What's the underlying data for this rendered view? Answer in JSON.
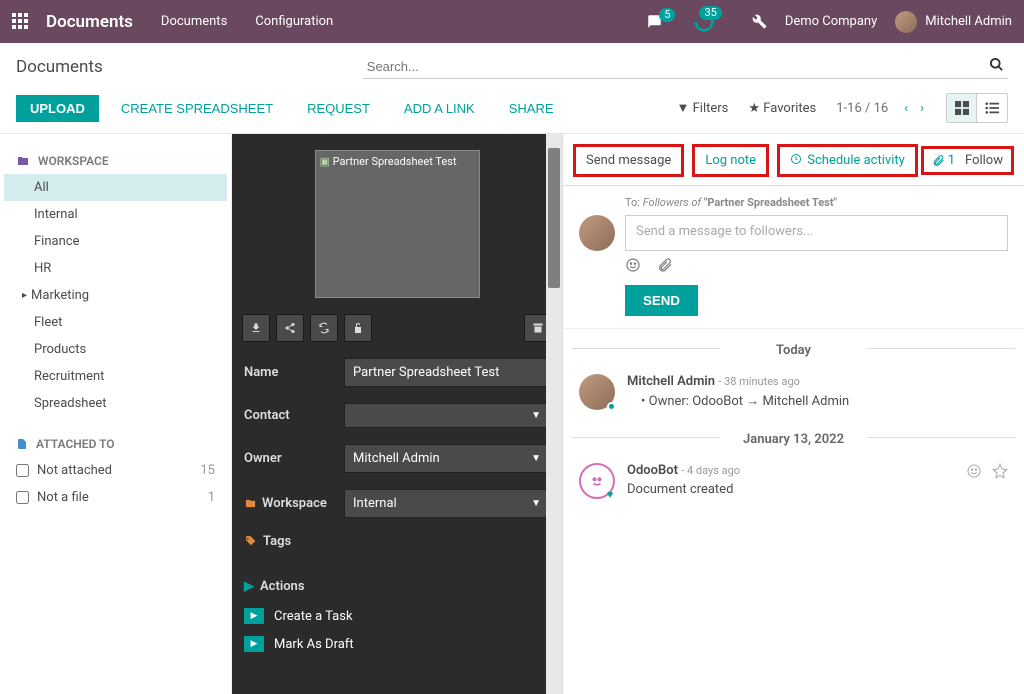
{
  "topnav": {
    "brand": "Documents",
    "menu": [
      "Documents",
      "Configuration"
    ],
    "msg_badge": "5",
    "clock_badge": "35",
    "company": "Demo Company",
    "user": "Mitchell Admin"
  },
  "header": {
    "title": "Documents",
    "search_placeholder": "Search..."
  },
  "toolbar": {
    "upload": "UPLOAD",
    "create_spreadsheet": "CREATE SPREADSHEET",
    "request": "REQUEST",
    "add_link": "ADD A LINK",
    "share": "SHARE",
    "filters": "Filters",
    "favorites": "Favorites",
    "pager": "1-16 / 16"
  },
  "sidebar": {
    "workspace_label": "WORKSPACE",
    "items": [
      {
        "label": "All",
        "active": true
      },
      {
        "label": "Internal"
      },
      {
        "label": "Finance"
      },
      {
        "label": "HR"
      },
      {
        "label": "Marketing",
        "caret": true
      },
      {
        "label": "Fleet"
      },
      {
        "label": "Products"
      },
      {
        "label": "Recruitment"
      },
      {
        "label": "Spreadsheet"
      }
    ],
    "attached_label": "ATTACHED TO",
    "filters": [
      {
        "label": "Not attached",
        "count": "15"
      },
      {
        "label": "Not a file",
        "count": "1"
      }
    ]
  },
  "detail": {
    "thumb_label": "Partner Spreadsheet Test",
    "name_label": "Name",
    "name_value": "Partner Spreadsheet Test",
    "contact_label": "Contact",
    "contact_value": "",
    "owner_label": "Owner",
    "owner_value": "Mitchell Admin",
    "workspace_label": "Workspace",
    "workspace_value": "Internal",
    "tags_label": "Tags",
    "actions_label": "Actions",
    "action1": "Create a Task",
    "action2": "Mark As Draft"
  },
  "chatter": {
    "tab_send": "Send message",
    "tab_log": "Log note",
    "tab_activity": "Schedule activity",
    "attach_count": "1",
    "follow": "Follow",
    "to_prefix": "To: ",
    "to_label": "Followers of ",
    "to_doc": "\"Partner Spreadsheet Test\"",
    "compose_placeholder": "Send a message to followers...",
    "send": "SEND",
    "today": "Today",
    "msg1_who": "Mitchell Admin",
    "msg1_when": "- 38 minutes ago",
    "msg1_body": "Owner: OdooBot → Mitchell Admin",
    "date2": "January 13, 2022",
    "msg2_who": "OdooBot",
    "msg2_when": "- 4 days ago",
    "msg2_body": "Document created"
  }
}
